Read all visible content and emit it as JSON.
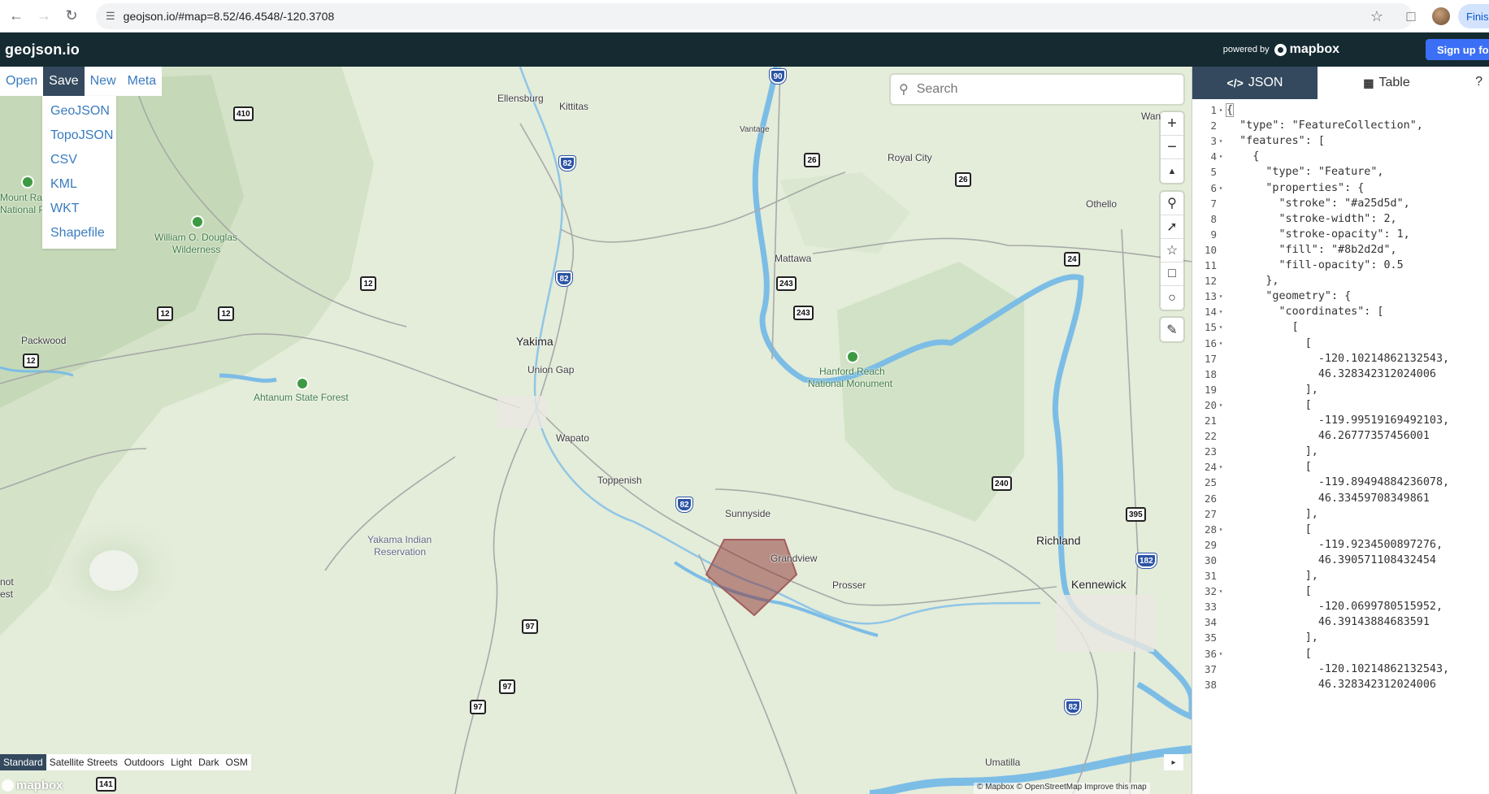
{
  "browser": {
    "url": "geojson.io/#map=8.52/46.4548/-120.3708",
    "finish_label": "Finis"
  },
  "app": {
    "logo": "geojson.io",
    "powered_by": "powered by",
    "mapbox_brand": "mapbox",
    "signup_label": "Sign up for"
  },
  "menu": {
    "items": [
      "Open",
      "Save",
      "New",
      "Meta"
    ],
    "active": "Save",
    "save_options": [
      "GeoJSON",
      "TopoJSON",
      "CSV",
      "KML",
      "WKT",
      "Shapefile"
    ]
  },
  "search": {
    "placeholder": "Search"
  },
  "map_controls": {
    "nav": [
      "zoom-in",
      "zoom-out",
      "compass"
    ],
    "draw": [
      "draw-marker",
      "draw-line",
      "draw-polygon",
      "draw-rectangle",
      "draw-circle"
    ],
    "edit": [
      "edit-features"
    ]
  },
  "map": {
    "places": [
      {
        "name": "Ellensburg",
        "type": "town"
      },
      {
        "name": "Kittitas",
        "type": "town"
      },
      {
        "name": "Vantage",
        "type": "small"
      },
      {
        "name": "Royal City",
        "type": "town"
      },
      {
        "name": "Othello",
        "type": "town"
      },
      {
        "name": "Mattawa",
        "type": "town"
      },
      {
        "name": "Yakima",
        "type": "city"
      },
      {
        "name": "Union Gap",
        "type": "town"
      },
      {
        "name": "Wapato",
        "type": "town"
      },
      {
        "name": "Toppenish",
        "type": "town"
      },
      {
        "name": "Sunnyside",
        "type": "town"
      },
      {
        "name": "Grandview",
        "type": "town"
      },
      {
        "name": "Prosser",
        "type": "town"
      },
      {
        "name": "Richland",
        "type": "city"
      },
      {
        "name": "Kennewick",
        "type": "city"
      },
      {
        "name": "Packwood",
        "type": "town"
      },
      {
        "name": "Umatilla",
        "type": "town"
      },
      {
        "name": "Wan",
        "type": "town"
      },
      {
        "name": "Mount Rai",
        "type": "park"
      },
      {
        "name": "National P",
        "type": "park"
      },
      {
        "name": "William O. Douglas",
        "type": "park"
      },
      {
        "name": "Wilderness",
        "type": "park"
      },
      {
        "name": "Ahtanum State Forest",
        "type": "park"
      },
      {
        "name": "Hanford Reach",
        "type": "park"
      },
      {
        "name": "National Monument",
        "type": "park"
      },
      {
        "name": "Yakama Indian",
        "type": "reservation"
      },
      {
        "name": "Reservation",
        "type": "reservation"
      },
      {
        "name": "not",
        "type": "town"
      },
      {
        "name": "est",
        "type": "town"
      }
    ],
    "shields": [
      "410",
      "90",
      "82",
      "26",
      "26",
      "24",
      "243",
      "243",
      "12",
      "12",
      "12",
      "12",
      "82",
      "82",
      "240",
      "395",
      "182",
      "97",
      "97",
      "97",
      "82",
      "141"
    ],
    "polygon": {
      "stroke": "#a25d5d",
      "fill": "#8b2d2d",
      "fill_opacity": 0.5
    }
  },
  "styles": {
    "items": [
      "Standard",
      "Satellite Streets",
      "Outdoors",
      "Light",
      "Dark",
      "OSM"
    ],
    "active": "Standard"
  },
  "attribution": "© Mapbox © OpenStreetMap  Improve this map",
  "collapse_icon": "▸",
  "panel": {
    "tabs": [
      {
        "label": "JSON",
        "icon": "code-icon",
        "active": true
      },
      {
        "label": "Table",
        "icon": "table-icon",
        "active": false
      }
    ],
    "help_label": "?"
  },
  "editor": {
    "lines": [
      {
        "n": "1",
        "fold": true,
        "text": "{"
      },
      {
        "n": "2",
        "fold": false,
        "text": "  \"type\": \"FeatureCollection\","
      },
      {
        "n": "3",
        "fold": true,
        "text": "  \"features\": ["
      },
      {
        "n": "4",
        "fold": true,
        "text": "    {"
      },
      {
        "n": "5",
        "fold": false,
        "text": "      \"type\": \"Feature\","
      },
      {
        "n": "6",
        "fold": true,
        "text": "      \"properties\": {"
      },
      {
        "n": "7",
        "fold": false,
        "text": "        \"stroke\": \"#a25d5d\","
      },
      {
        "n": "8",
        "fold": false,
        "text": "        \"stroke-width\": 2,"
      },
      {
        "n": "9",
        "fold": false,
        "text": "        \"stroke-opacity\": 1,"
      },
      {
        "n": "10",
        "fold": false,
        "text": "        \"fill\": \"#8b2d2d\","
      },
      {
        "n": "11",
        "fold": false,
        "text": "        \"fill-opacity\": 0.5"
      },
      {
        "n": "12",
        "fold": false,
        "text": "      },"
      },
      {
        "n": "13",
        "fold": true,
        "text": "      \"geometry\": {"
      },
      {
        "n": "14",
        "fold": true,
        "text": "        \"coordinates\": ["
      },
      {
        "n": "15",
        "fold": true,
        "text": "          ["
      },
      {
        "n": "16",
        "fold": true,
        "text": "            ["
      },
      {
        "n": "17",
        "fold": false,
        "text": "              -120.10214862132543,"
      },
      {
        "n": "18",
        "fold": false,
        "text": "              46.328342312024006"
      },
      {
        "n": "19",
        "fold": false,
        "text": "            ],"
      },
      {
        "n": "20",
        "fold": true,
        "text": "            ["
      },
      {
        "n": "21",
        "fold": false,
        "text": "              -119.99519169492103,"
      },
      {
        "n": "22",
        "fold": false,
        "text": "              46.26777357456001"
      },
      {
        "n": "23",
        "fold": false,
        "text": "            ],"
      },
      {
        "n": "24",
        "fold": true,
        "text": "            ["
      },
      {
        "n": "25",
        "fold": false,
        "text": "              -119.89494884236078,"
      },
      {
        "n": "26",
        "fold": false,
        "text": "              46.33459708349861"
      },
      {
        "n": "27",
        "fold": false,
        "text": "            ],"
      },
      {
        "n": "28",
        "fold": true,
        "text": "            ["
      },
      {
        "n": "29",
        "fold": false,
        "text": "              -119.9234500897276,"
      },
      {
        "n": "30",
        "fold": false,
        "text": "              46.390571108432454"
      },
      {
        "n": "31",
        "fold": false,
        "text": "            ],"
      },
      {
        "n": "32",
        "fold": true,
        "text": "            ["
      },
      {
        "n": "33",
        "fold": false,
        "text": "              -120.0699780515952,"
      },
      {
        "n": "34",
        "fold": false,
        "text": "              46.39143884683591"
      },
      {
        "n": "35",
        "fold": false,
        "text": "            ],"
      },
      {
        "n": "36",
        "fold": true,
        "text": "            ["
      },
      {
        "n": "37",
        "fold": false,
        "text": "              -120.10214862132543,"
      },
      {
        "n": "38",
        "fold": false,
        "text": "              46.328342312024006"
      }
    ]
  }
}
